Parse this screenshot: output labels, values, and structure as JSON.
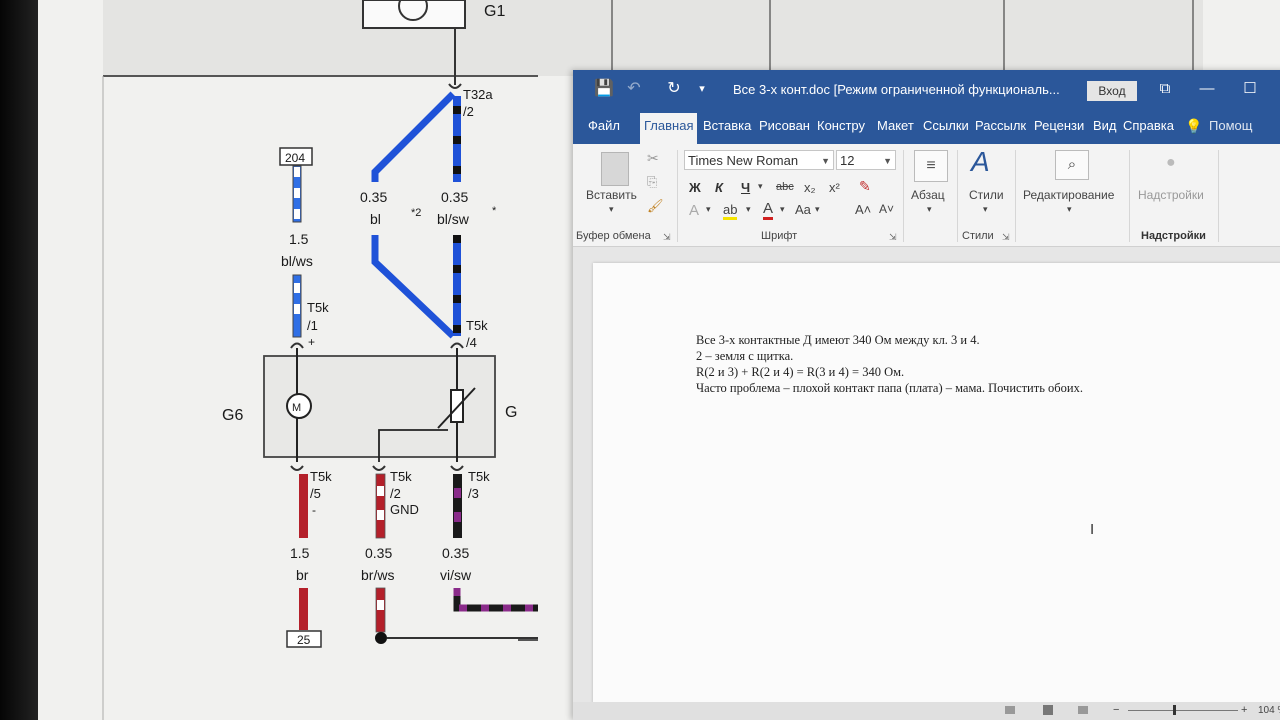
{
  "diagram": {
    "component_top": "G1",
    "connector_top": "T32a",
    "connector_top_pin": "/2",
    "ref_204": "204",
    "ref_25": "25",
    "wire_left_size": "1.5",
    "wire_left_color": "bl/ws",
    "wire_mid_size": "0.35",
    "wire_mid_color": "bl",
    "wire_mid_note": "*2",
    "wire_right_size": "0.35",
    "wire_right_color": "bl/sw",
    "wire_right_note": "*",
    "conn1_label": "T5k",
    "conn1_pin": "/1",
    "conn1_sign": "+",
    "conn4_label": "T5k",
    "conn4_pin": "/4",
    "g6_label": "G6",
    "g_label": "G",
    "conn5_label": "T5k",
    "conn5_pin": "/5",
    "conn5_sign": "-",
    "conn2_label": "T5k",
    "conn2_pin": "/2",
    "conn2_sub": "GND",
    "conn3_label": "T5k",
    "conn3_pin": "/3",
    "bottom_left_size": "1.5",
    "bottom_left_color": "br",
    "bottom_mid_size": "0.35",
    "bottom_mid_color": "br/ws",
    "bottom_right_size": "0.35",
    "bottom_right_color": "vi/sw"
  },
  "word": {
    "title": "Все 3-х конт.doc [Режим ограниченной функциональ...",
    "login": "Вход",
    "tabs": [
      "Файл",
      "Главная",
      "Вставка",
      "Рисован",
      "Констру",
      "Макет",
      "Ссылки",
      "Рассылк",
      "Рецензи",
      "Вид",
      "Справка",
      "Помощ"
    ],
    "ribbon": {
      "paste": "Вставить",
      "clipboard_group": "Буфер обмена",
      "font_name": "Times New Roman",
      "font_size": "12",
      "bold": "Ж",
      "italic": "К",
      "underline": "Ч",
      "strike": "abc",
      "subscript": "x₂",
      "superscript": "x²",
      "font_group": "Шрифт",
      "paragraph": "Абзац",
      "styles": "Стили",
      "styles_group": "Стили",
      "editing": "Редактирование",
      "addins": "Надстройки",
      "addins_group": "Надстройки"
    },
    "document": {
      "lines": [
        "Все 3-х контактные Д имеют 340 Ом между кл. 3 и 4.",
        "2 – земля с щитка.",
        "R(2 и 3) + R(2 и 4) =  R(3 и 4) = 340 Ом.",
        "Часто проблема – плохой контакт папа (плата) – мама. Почистить обоих."
      ]
    },
    "status": {
      "zoom": "104 %"
    }
  }
}
